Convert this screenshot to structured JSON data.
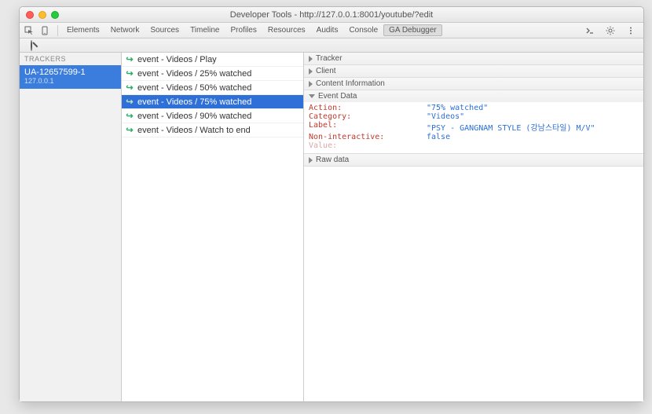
{
  "window": {
    "title": "Developer Tools - http://127.0.0.1:8001/youtube/?edit"
  },
  "devtools_tabs": [
    "Elements",
    "Network",
    "Sources",
    "Timeline",
    "Profiles",
    "Resources",
    "Audits",
    "Console",
    "GA Debugger"
  ],
  "devtools_active_tab": 8,
  "sidebar": {
    "header": "TRACKERS",
    "trackers": [
      {
        "id": "UA-12657599-1",
        "host": "127.0.0.1"
      }
    ]
  },
  "events": [
    {
      "label": "event - Videos / Play"
    },
    {
      "label": "event - Videos / 25% watched"
    },
    {
      "label": "event - Videos / 50% watched"
    },
    {
      "label": "event - Videos / 75% watched",
      "selected": true
    },
    {
      "label": "event - Videos / 90% watched"
    },
    {
      "label": "event - Videos / Watch to end"
    }
  ],
  "detail_sections": [
    {
      "title": "Tracker",
      "expanded": false
    },
    {
      "title": "Client",
      "expanded": false
    },
    {
      "title": "Content Information",
      "expanded": false
    },
    {
      "title": "Event Data",
      "expanded": true
    },
    {
      "title": "Raw data",
      "expanded": false
    }
  ],
  "event_data": {
    "rows": [
      {
        "key": "Action:",
        "value": "\"75% watched\""
      },
      {
        "key": "Category:",
        "value": "\"Videos\""
      },
      {
        "key": "Label:",
        "value": "\"PSY - GANGNAM STYLE (강남스타일) M/V\""
      },
      {
        "key": "Non-interactive:",
        "value": "false",
        "bool": true
      },
      {
        "key": "Value:",
        "value": "",
        "muted": true
      }
    ]
  }
}
